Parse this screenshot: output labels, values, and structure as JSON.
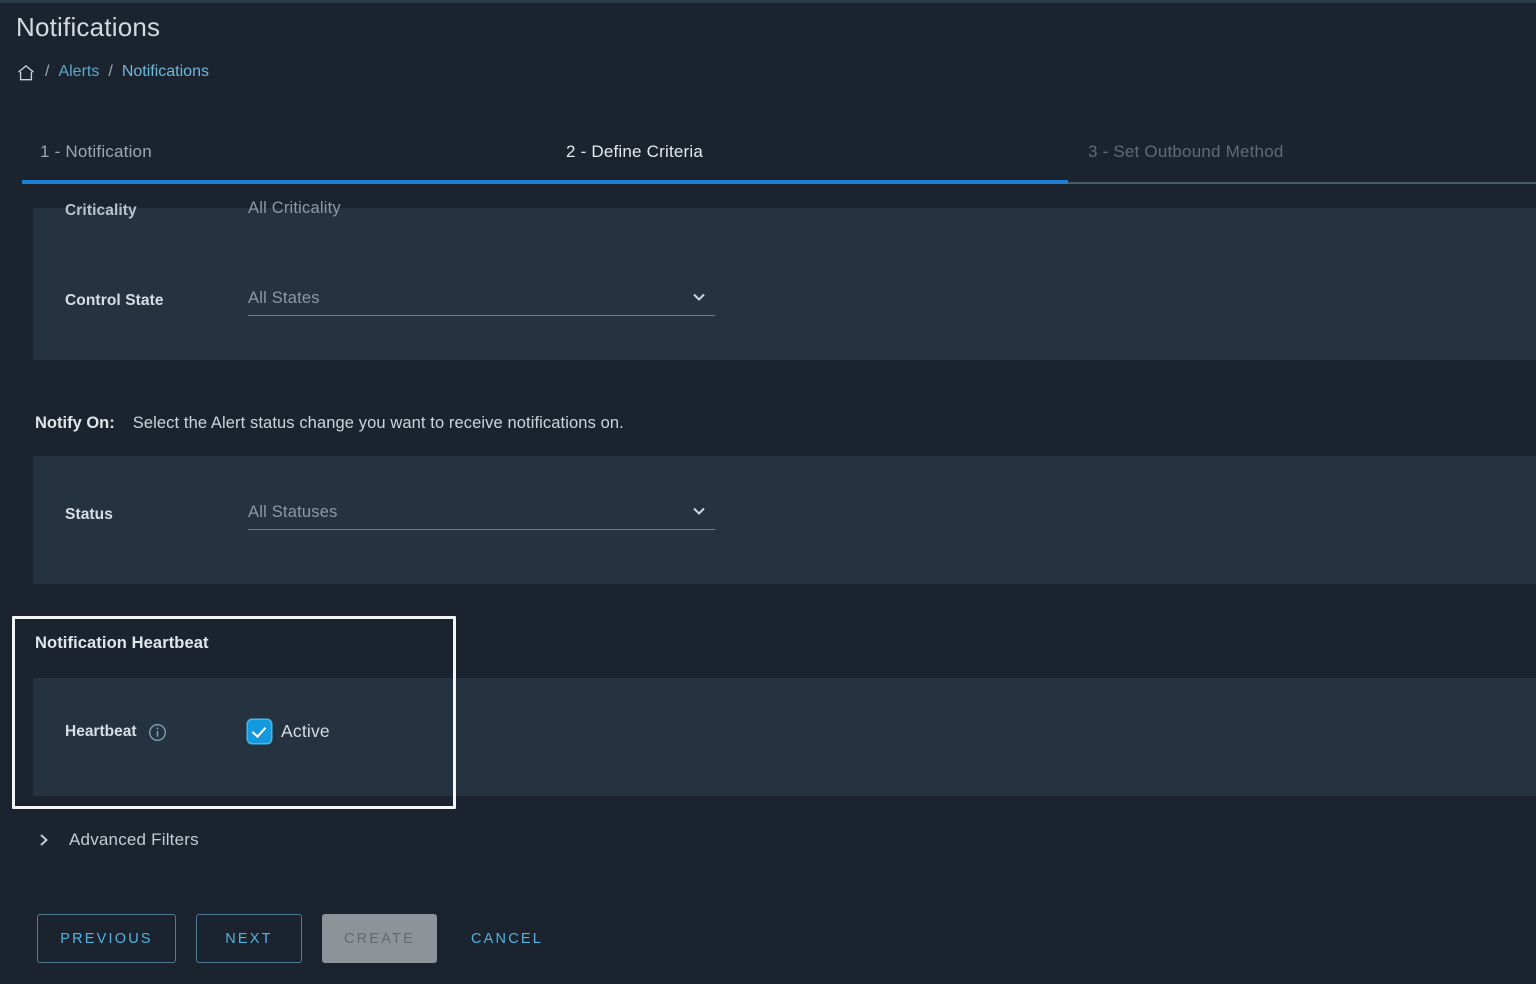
{
  "header": {
    "title": "Notifications",
    "breadcrumb": {
      "home_icon": "home-icon",
      "separator": "/",
      "items": [
        "Alerts",
        "Notifications"
      ]
    }
  },
  "wizard": {
    "tabs": [
      {
        "label": "1 - Notification",
        "state": "completed"
      },
      {
        "label": "2 - Define Criteria",
        "state": "active"
      },
      {
        "label": "3 - Set Outbound Method",
        "state": "upcoming"
      }
    ],
    "progress_color": "#1d7fd4"
  },
  "criteria_panel": {
    "clipped_row": {
      "label": "Criticality",
      "value": "All Criticality"
    },
    "control_state": {
      "label": "Control State",
      "value": "All States",
      "caret_icon": "chevron-down-icon"
    }
  },
  "notify_on": {
    "label": "Notify On:",
    "description": "Select the Alert status change you want to receive notifications on."
  },
  "status_panel": {
    "label": "Status",
    "value": "All Statuses",
    "caret_icon": "chevron-down-icon"
  },
  "heartbeat": {
    "section_title": "Notification Heartbeat",
    "label": "Heartbeat",
    "info_icon": "info-icon",
    "checkbox_label": "Active",
    "checked": true,
    "checkbox_color": "#139ade",
    "highlight_border_color": "#f2f5f7"
  },
  "advanced_filters": {
    "label": "Advanced Filters",
    "chevron_icon": "chevron-right-icon",
    "expanded": false
  },
  "footer": {
    "previous_label": "PREVIOUS",
    "next_label": "NEXT",
    "create_label": "CREATE",
    "cancel_label": "CANCEL",
    "create_disabled": true,
    "accent_color": "#52b3e0"
  }
}
